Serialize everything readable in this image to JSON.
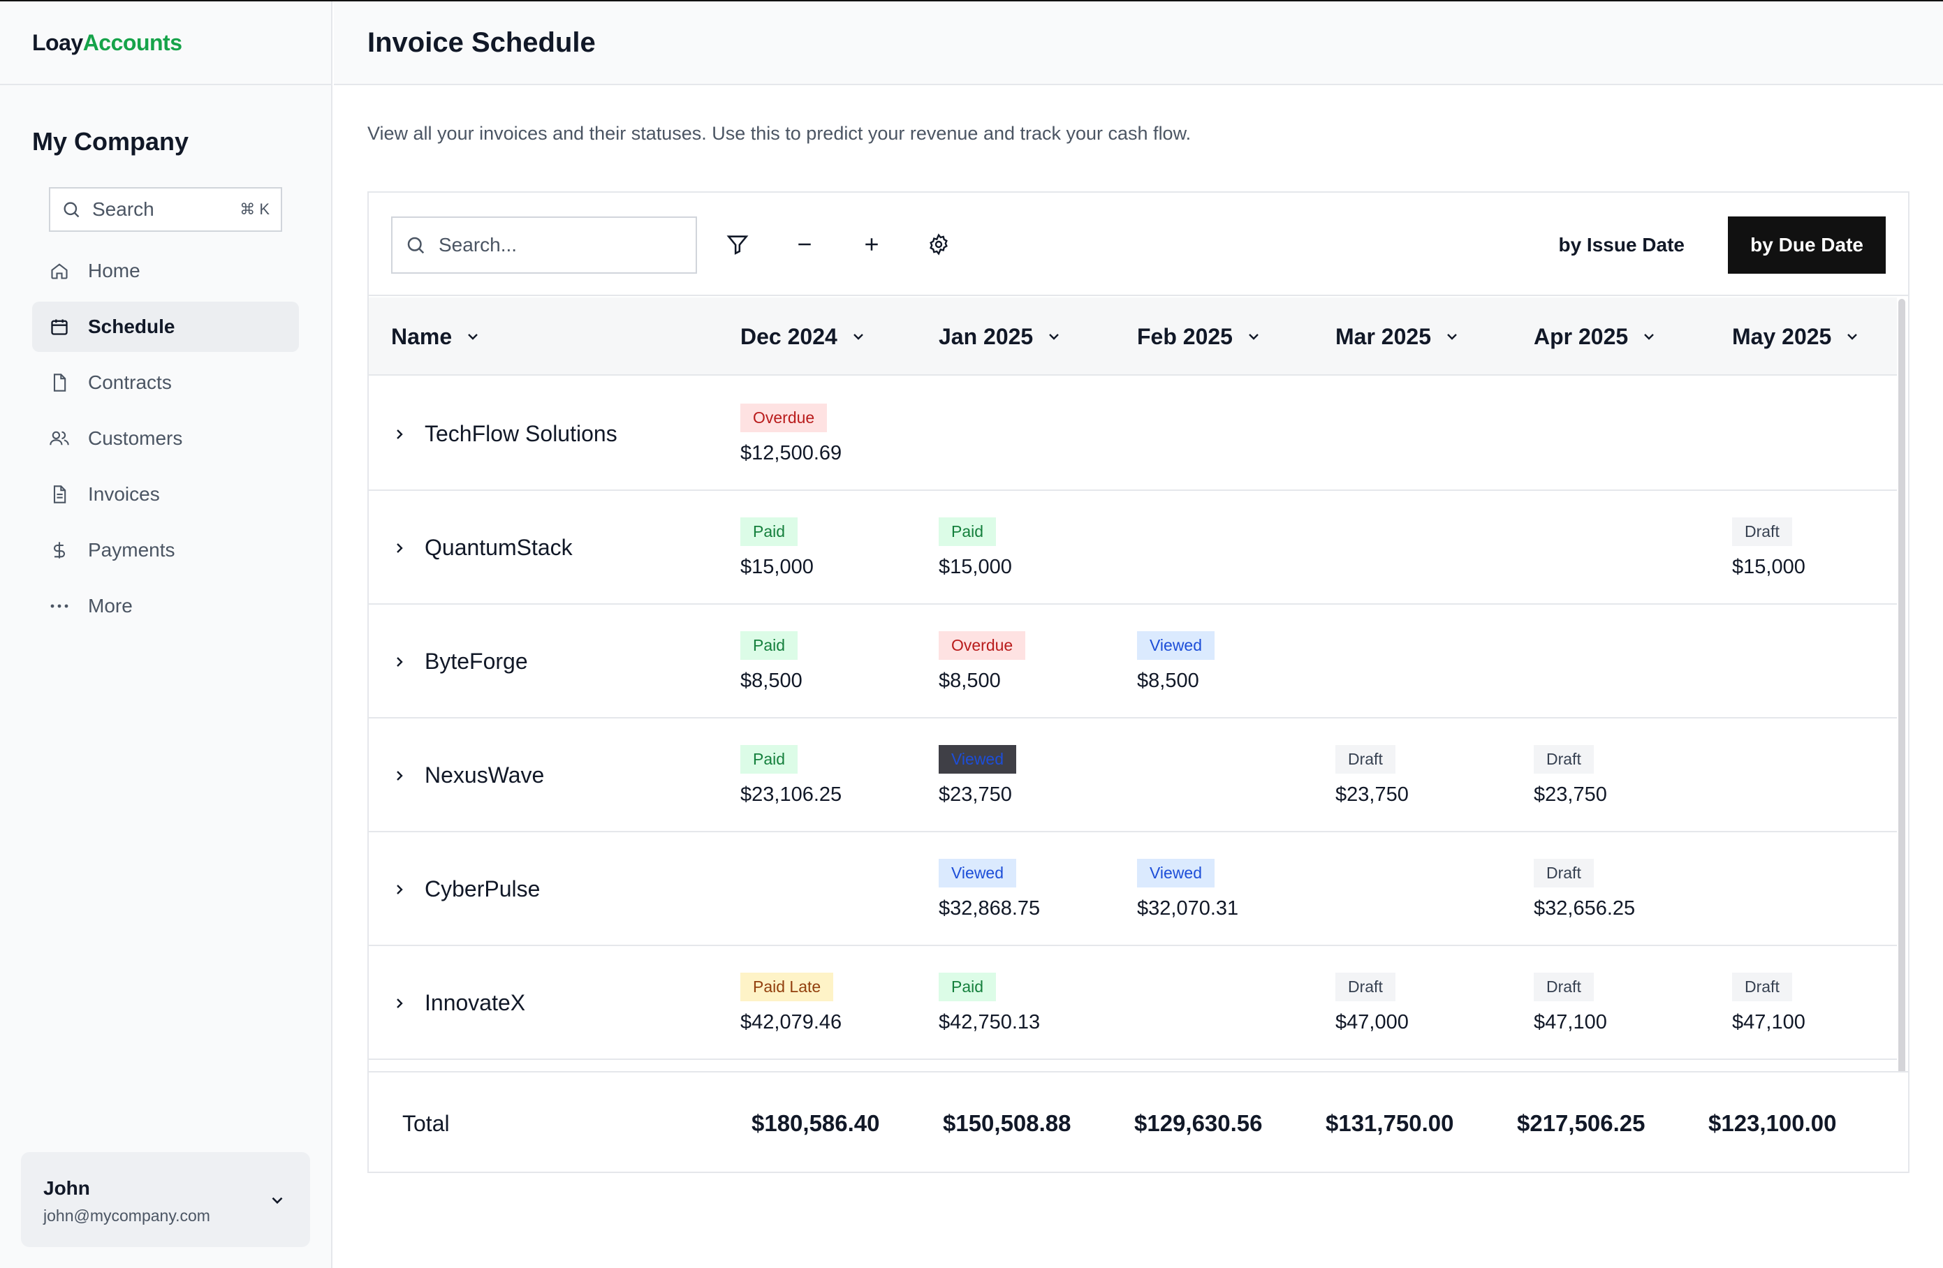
{
  "brand": {
    "part1": "Loay",
    "part2": "Accounts",
    "accent_color": "#16a34a"
  },
  "sidebar": {
    "company": "My Company",
    "search_placeholder": "Search",
    "search_shortcut": "⌘ K",
    "items": [
      {
        "label": "Home",
        "icon": "home-icon"
      },
      {
        "label": "Schedule",
        "icon": "calendar-icon",
        "active": true
      },
      {
        "label": "Contracts",
        "icon": "file-icon"
      },
      {
        "label": "Customers",
        "icon": "users-icon"
      },
      {
        "label": "Invoices",
        "icon": "document-icon"
      },
      {
        "label": "Payments",
        "icon": "dollar-icon"
      },
      {
        "label": "More",
        "icon": "more-icon"
      }
    ],
    "user": {
      "name": "John",
      "email": "john@mycompany.com"
    }
  },
  "header": {
    "title": "Invoice Schedule"
  },
  "description": "View all your invoices and their statuses. Use this to predict your revenue and track your cash flow.",
  "toolbar": {
    "search_placeholder": "Search...",
    "by_issue_date": "by Issue Date",
    "by_due_date": "by Due Date"
  },
  "table": {
    "columns": [
      "Name",
      "Dec 2024",
      "Jan 2025",
      "Feb 2025",
      "Mar 2025",
      "Apr 2025",
      "May 2025"
    ],
    "rows": [
      {
        "name": "TechFlow Solutions",
        "cells": [
          {
            "status": "Overdue",
            "amount": "$12,500.69"
          },
          null,
          null,
          null,
          null,
          null
        ]
      },
      {
        "name": "QuantumStack",
        "cells": [
          {
            "status": "Paid",
            "amount": "$15,000"
          },
          {
            "status": "Paid",
            "amount": "$15,000"
          },
          null,
          null,
          null,
          {
            "status": "Draft",
            "amount": "$15,000"
          }
        ]
      },
      {
        "name": "ByteForge",
        "cells": [
          {
            "status": "Paid",
            "amount": "$8,500"
          },
          {
            "status": "Overdue",
            "amount": "$8,500"
          },
          {
            "status": "Viewed",
            "amount": "$8,500"
          },
          null,
          null,
          null
        ]
      },
      {
        "name": "NexusWave",
        "cells": [
          {
            "status": "Paid",
            "amount": "$23,106.25"
          },
          {
            "status": "Viewed",
            "amount": "$23,750",
            "highlighted": true
          },
          null,
          {
            "status": "Draft",
            "amount": "$23,750"
          },
          {
            "status": "Draft",
            "amount": "$23,750"
          },
          null
        ]
      },
      {
        "name": "CyberPulse",
        "cells": [
          null,
          {
            "status": "Viewed",
            "amount": "$32,868.75"
          },
          {
            "status": "Viewed",
            "amount": "$32,070.31"
          },
          null,
          {
            "status": "Draft",
            "amount": "$32,656.25"
          },
          null
        ]
      },
      {
        "name": "InnovateX",
        "cells": [
          {
            "status": "Paid Late",
            "amount": "$42,079.46"
          },
          {
            "status": "Paid",
            "amount": "$42,750.13"
          },
          null,
          {
            "status": "Draft",
            "amount": "$47,000"
          },
          {
            "status": "Draft",
            "amount": "$47,100"
          },
          {
            "status": "Draft",
            "amount": "$47,100"
          }
        ]
      }
    ],
    "total_label": "Total",
    "totals": [
      "$180,586.40",
      "$150,508.88",
      "$129,630.56",
      "$131,750.00",
      "$217,506.25",
      "$123,100.00"
    ]
  }
}
